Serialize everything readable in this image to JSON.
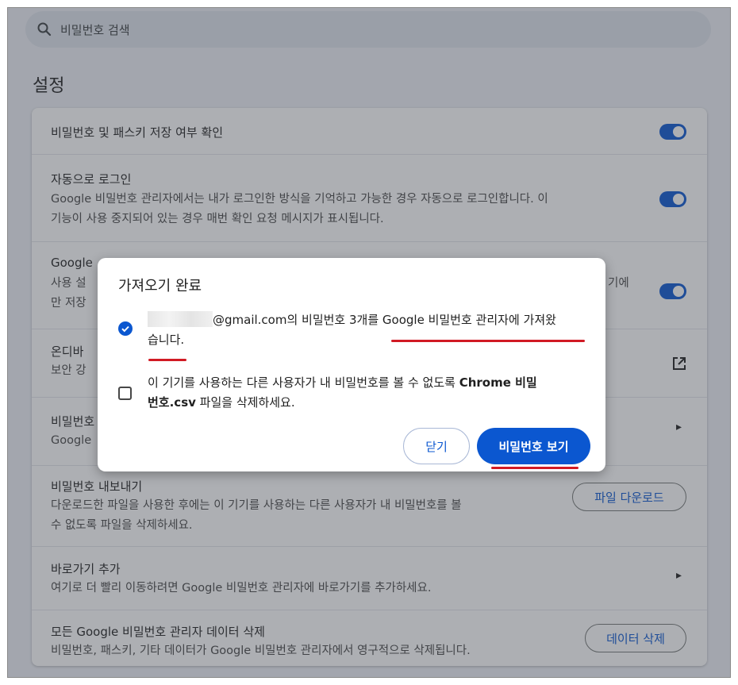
{
  "search": {
    "placeholder": "비밀번호 검색",
    "icon": "search-icon"
  },
  "page_title": "설정",
  "settings": {
    "save_prompt": {
      "title": "비밀번호 및 패스키 저장 여부 확인",
      "enabled": true
    },
    "auto_signin": {
      "title": "자동으로 로그인",
      "desc_line1": "Google 비밀번호 관리자에서는 내가 로그인한 방식을 기억하고 가능한 경우 자동으로 로그인합니다. 이",
      "desc_line2": "기능이 사용 중지되어 있는 경우 매번 확인 요청 메시지가 표시됩니다.",
      "enabled": true
    },
    "row3": {
      "title": "Google",
      "desc_line1_left": "사용 설",
      "desc_line1_right": "기에",
      "desc_line2": "만 저장",
      "enabled": true
    },
    "row4": {
      "title": "온디바",
      "desc": "보안 강",
      "icon": "open-in-new-icon"
    },
    "row5": {
      "title": "비밀번호",
      "desc": "Google",
      "icon": "chevron-right-icon"
    },
    "export": {
      "title": "비밀번호 내보내기",
      "desc_line1": "다운로드한 파일을 사용한 후에는 이 기기를 사용하는 다른 사용자가 내 비밀번호를 볼",
      "desc_line2": "수 없도록 파일을 삭제하세요.",
      "button": "파일 다운로드"
    },
    "shortcut": {
      "title": "바로가기 추가",
      "desc": "여기로 더 빨리 이동하려면 Google 비밀번호 관리자에 바로가기를 추가하세요.",
      "icon": "chevron-right-icon"
    },
    "delete_data": {
      "title": "모든 Google 비밀번호 관리자 데이터 삭제",
      "desc": "비밀번호, 패스키, 기타 데이터가 Google 비밀번호 관리자에서 영구적으로 삭제됩니다.",
      "button": "데이터 삭제"
    }
  },
  "dialog": {
    "title": "가져오기 완료",
    "import_msg": {
      "email_suffix": "@gmail.com의 비밀번호 3개를 ",
      "highlight": "Google 비밀번호 관리자에 가져왔",
      "line2": "습니다.",
      "checked": true
    },
    "delete_msg": {
      "line1_prefix": "이 기기를 사용하는 다른 사용자가 내 비밀번호를 볼 수 없도록 ",
      "line1_bold": "Chrome 비밀",
      "line2_bold": "번호.csv",
      "line2_rest": " 파일을 삭제하세요.",
      "checked": false
    },
    "close_button": "닫기",
    "view_button": "비밀번호 보기"
  },
  "colors": {
    "accent": "#0b57d0",
    "annotation": "#d11a24"
  }
}
